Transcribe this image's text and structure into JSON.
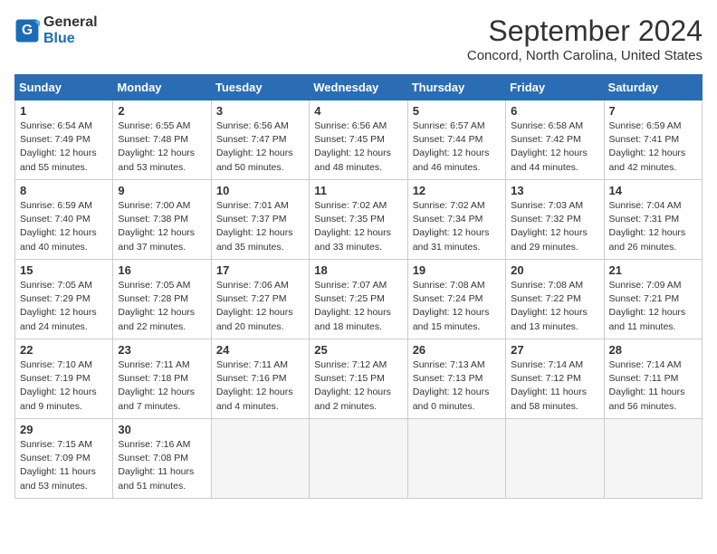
{
  "header": {
    "logo_general": "General",
    "logo_blue": "Blue",
    "title": "September 2024",
    "subtitle": "Concord, North Carolina, United States"
  },
  "days_of_week": [
    "Sunday",
    "Monday",
    "Tuesday",
    "Wednesday",
    "Thursday",
    "Friday",
    "Saturday"
  ],
  "weeks": [
    [
      {
        "day": "1",
        "info": "Sunrise: 6:54 AM\nSunset: 7:49 PM\nDaylight: 12 hours\nand 55 minutes."
      },
      {
        "day": "2",
        "info": "Sunrise: 6:55 AM\nSunset: 7:48 PM\nDaylight: 12 hours\nand 53 minutes."
      },
      {
        "day": "3",
        "info": "Sunrise: 6:56 AM\nSunset: 7:47 PM\nDaylight: 12 hours\nand 50 minutes."
      },
      {
        "day": "4",
        "info": "Sunrise: 6:56 AM\nSunset: 7:45 PM\nDaylight: 12 hours\nand 48 minutes."
      },
      {
        "day": "5",
        "info": "Sunrise: 6:57 AM\nSunset: 7:44 PM\nDaylight: 12 hours\nand 46 minutes."
      },
      {
        "day": "6",
        "info": "Sunrise: 6:58 AM\nSunset: 7:42 PM\nDaylight: 12 hours\nand 44 minutes."
      },
      {
        "day": "7",
        "info": "Sunrise: 6:59 AM\nSunset: 7:41 PM\nDaylight: 12 hours\nand 42 minutes."
      }
    ],
    [
      {
        "day": "8",
        "info": "Sunrise: 6:59 AM\nSunset: 7:40 PM\nDaylight: 12 hours\nand 40 minutes."
      },
      {
        "day": "9",
        "info": "Sunrise: 7:00 AM\nSunset: 7:38 PM\nDaylight: 12 hours\nand 37 minutes."
      },
      {
        "day": "10",
        "info": "Sunrise: 7:01 AM\nSunset: 7:37 PM\nDaylight: 12 hours\nand 35 minutes."
      },
      {
        "day": "11",
        "info": "Sunrise: 7:02 AM\nSunset: 7:35 PM\nDaylight: 12 hours\nand 33 minutes."
      },
      {
        "day": "12",
        "info": "Sunrise: 7:02 AM\nSunset: 7:34 PM\nDaylight: 12 hours\nand 31 minutes."
      },
      {
        "day": "13",
        "info": "Sunrise: 7:03 AM\nSunset: 7:32 PM\nDaylight: 12 hours\nand 29 minutes."
      },
      {
        "day": "14",
        "info": "Sunrise: 7:04 AM\nSunset: 7:31 PM\nDaylight: 12 hours\nand 26 minutes."
      }
    ],
    [
      {
        "day": "15",
        "info": "Sunrise: 7:05 AM\nSunset: 7:29 PM\nDaylight: 12 hours\nand 24 minutes."
      },
      {
        "day": "16",
        "info": "Sunrise: 7:05 AM\nSunset: 7:28 PM\nDaylight: 12 hours\nand 22 minutes."
      },
      {
        "day": "17",
        "info": "Sunrise: 7:06 AM\nSunset: 7:27 PM\nDaylight: 12 hours\nand 20 minutes."
      },
      {
        "day": "18",
        "info": "Sunrise: 7:07 AM\nSunset: 7:25 PM\nDaylight: 12 hours\nand 18 minutes."
      },
      {
        "day": "19",
        "info": "Sunrise: 7:08 AM\nSunset: 7:24 PM\nDaylight: 12 hours\nand 15 minutes."
      },
      {
        "day": "20",
        "info": "Sunrise: 7:08 AM\nSunset: 7:22 PM\nDaylight: 12 hours\nand 13 minutes."
      },
      {
        "day": "21",
        "info": "Sunrise: 7:09 AM\nSunset: 7:21 PM\nDaylight: 12 hours\nand 11 minutes."
      }
    ],
    [
      {
        "day": "22",
        "info": "Sunrise: 7:10 AM\nSunset: 7:19 PM\nDaylight: 12 hours\nand 9 minutes."
      },
      {
        "day": "23",
        "info": "Sunrise: 7:11 AM\nSunset: 7:18 PM\nDaylight: 12 hours\nand 7 minutes."
      },
      {
        "day": "24",
        "info": "Sunrise: 7:11 AM\nSunset: 7:16 PM\nDaylight: 12 hours\nand 4 minutes."
      },
      {
        "day": "25",
        "info": "Sunrise: 7:12 AM\nSunset: 7:15 PM\nDaylight: 12 hours\nand 2 minutes."
      },
      {
        "day": "26",
        "info": "Sunrise: 7:13 AM\nSunset: 7:13 PM\nDaylight: 12 hours\nand 0 minutes."
      },
      {
        "day": "27",
        "info": "Sunrise: 7:14 AM\nSunset: 7:12 PM\nDaylight: 11 hours\nand 58 minutes."
      },
      {
        "day": "28",
        "info": "Sunrise: 7:14 AM\nSunset: 7:11 PM\nDaylight: 11 hours\nand 56 minutes."
      }
    ],
    [
      {
        "day": "29",
        "info": "Sunrise: 7:15 AM\nSunset: 7:09 PM\nDaylight: 11 hours\nand 53 minutes."
      },
      {
        "day": "30",
        "info": "Sunrise: 7:16 AM\nSunset: 7:08 PM\nDaylight: 11 hours\nand 51 minutes."
      },
      {
        "day": "",
        "info": ""
      },
      {
        "day": "",
        "info": ""
      },
      {
        "day": "",
        "info": ""
      },
      {
        "day": "",
        "info": ""
      },
      {
        "day": "",
        "info": ""
      }
    ]
  ]
}
